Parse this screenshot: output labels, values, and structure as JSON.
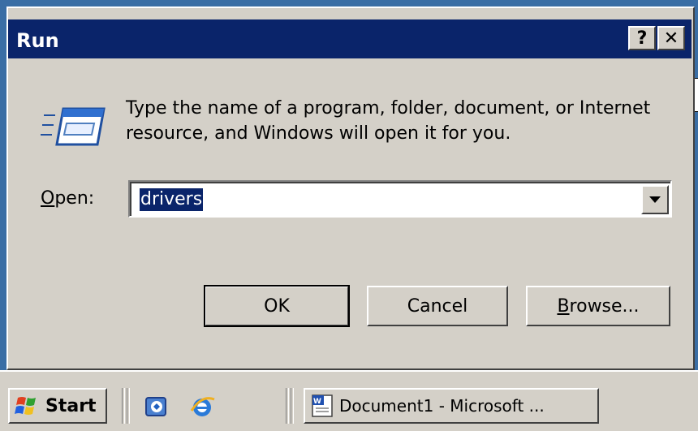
{
  "dialog": {
    "title": "Run",
    "help_label": "?",
    "close_label": "✕",
    "description": "Type the name of a program, folder, document, or Internet resource, and Windows will open it for you.",
    "open_label_accel": "O",
    "open_label_rest": "pen:",
    "open_value": "drivers",
    "buttons": {
      "ok": "OK",
      "cancel": "Cancel",
      "browse_accel": "B",
      "browse_rest": "rowse..."
    },
    "icons": {
      "run": "run-program-icon",
      "dropdown": "chevron-down-icon"
    }
  },
  "taskbar": {
    "start_label": "Start",
    "task_label": "Document1 - Microsoft ...",
    "icons": {
      "start": "windows-flag-icon",
      "quick_launch": [
        "show-desktop-icon",
        "internet-explorer-icon"
      ],
      "task": "word-document-icon"
    }
  },
  "colors": {
    "title_bar": "#0a246a",
    "face": "#d4d0c8",
    "desktop": "#3a6ea5",
    "selection": "#0a246a"
  }
}
